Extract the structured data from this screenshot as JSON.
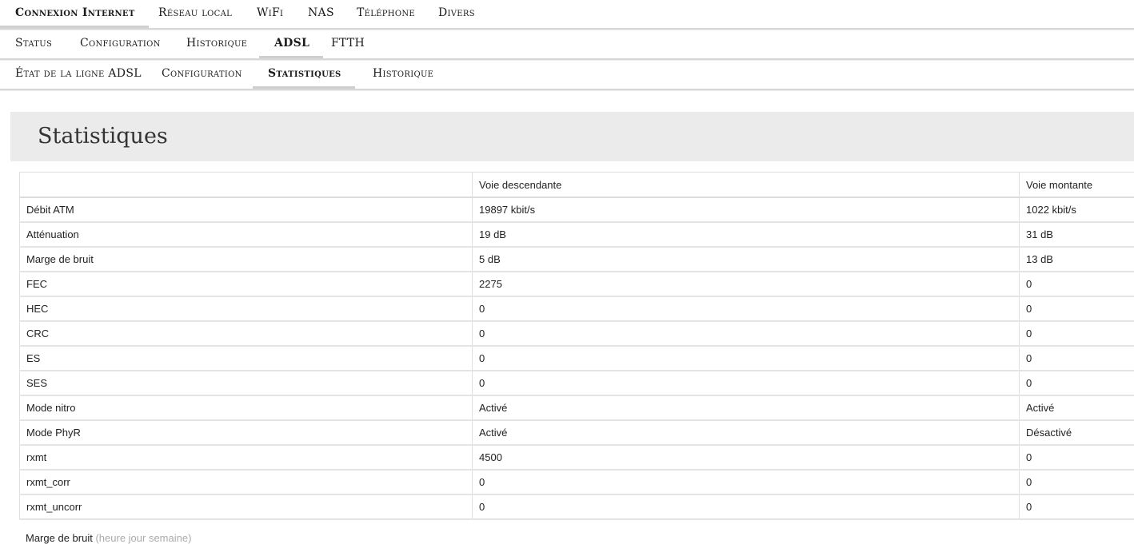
{
  "nav_main": [
    {
      "label": "Connexion Internet",
      "active": true
    },
    {
      "label": "Réseau local",
      "active": false
    },
    {
      "label": "WiFi",
      "active": false
    },
    {
      "label": "NAS",
      "active": false
    },
    {
      "label": "Téléphone",
      "active": false
    },
    {
      "label": "Divers",
      "active": false
    }
  ],
  "nav_sub": [
    {
      "label": "Status",
      "active": false
    },
    {
      "label": "Configuration",
      "active": false
    },
    {
      "label": "Historique",
      "active": false
    },
    {
      "label": "ADSL",
      "active": true
    },
    {
      "label": "FTTH",
      "active": false
    }
  ],
  "nav_adsl": [
    {
      "label": "État de la ligne ADSL",
      "active": false
    },
    {
      "label": "Configuration",
      "active": false
    },
    {
      "label": "Statistiques",
      "active": true
    },
    {
      "label": "Historique",
      "active": false
    }
  ],
  "page_title": "Statistiques",
  "table": {
    "headers": [
      "",
      "Voie descendante",
      "Voie montante"
    ],
    "rows": [
      [
        "Débit ATM",
        "19897 kbit/s",
        "1022 kbit/s"
      ],
      [
        "Atténuation",
        "19 dB",
        "31 dB"
      ],
      [
        "Marge de bruit",
        "5 dB",
        "13 dB"
      ],
      [
        "FEC",
        "2275",
        "0"
      ],
      [
        "HEC",
        "0",
        "0"
      ],
      [
        "CRC",
        "0",
        "0"
      ],
      [
        "ES",
        "0",
        "0"
      ],
      [
        "SES",
        "0",
        "0"
      ],
      [
        "Mode nitro",
        "Activé",
        "Activé"
      ],
      [
        "Mode PhyR",
        "Activé",
        "Désactivé"
      ],
      [
        "rxmt",
        "4500",
        "0"
      ],
      [
        "rxmt_corr",
        "0",
        "0"
      ],
      [
        "rxmt_uncorr",
        "0",
        "0"
      ]
    ]
  },
  "footer": {
    "label": "Marge de bruit",
    "paren_open": "(",
    "links": "heure jour semaine",
    "paren_close": ")"
  }
}
